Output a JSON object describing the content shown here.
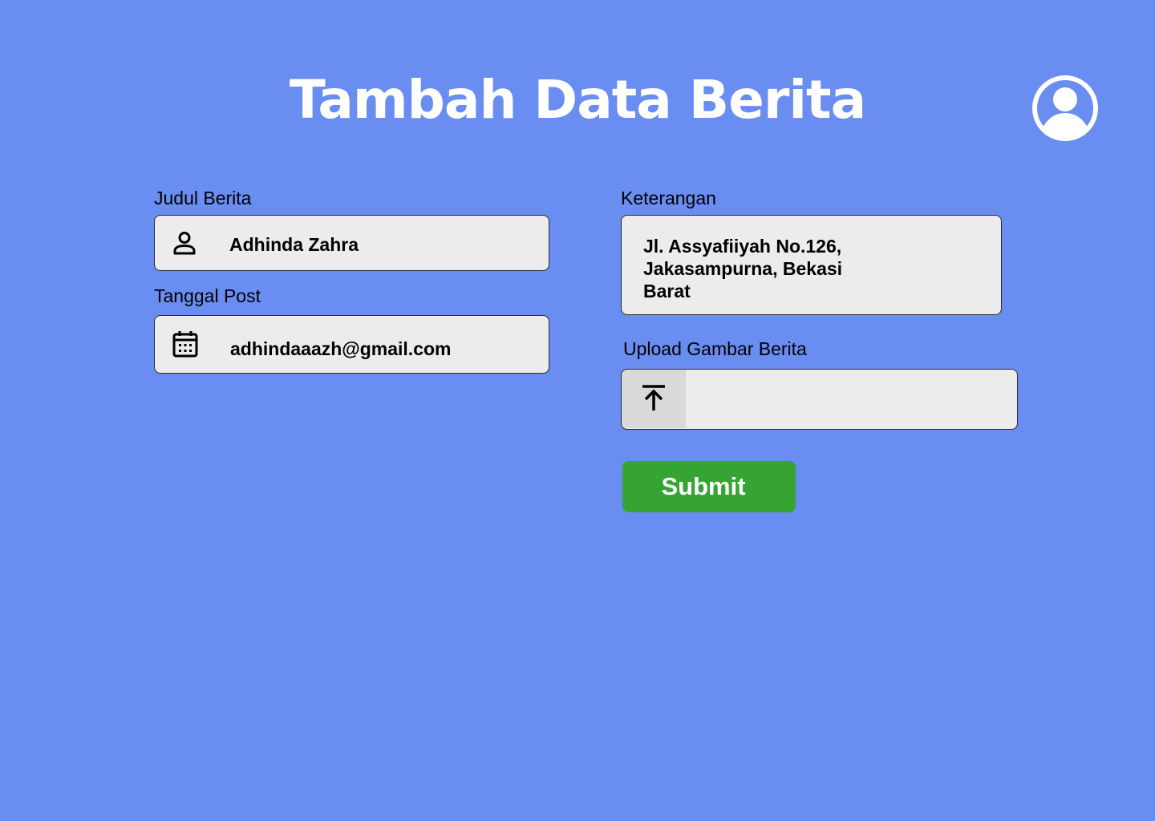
{
  "header": {
    "title": "Tambah Data Berita",
    "profile_icon": "user-circle-icon"
  },
  "form": {
    "judul_berita": {
      "label": "Judul Berita",
      "value": "Adhinda Zahra",
      "icon": "person-icon"
    },
    "tanggal_post": {
      "label": "Tanggal Post",
      "value": "adhindaaazh@gmail.com",
      "icon": "calendar-icon"
    },
    "keterangan": {
      "label": "Keterangan",
      "value": "Jl. Assyafiiyah No.126, Jakasampurna, Bekasi Barat"
    },
    "upload_gambar": {
      "label": "Upload Gambar Berita",
      "value": "",
      "icon": "upload-icon"
    },
    "submit_label": "Submit"
  },
  "colors": {
    "background": "#698df0",
    "field_background": "#ececec",
    "submit_button": "#36a433",
    "title_text": "#ffffff"
  }
}
